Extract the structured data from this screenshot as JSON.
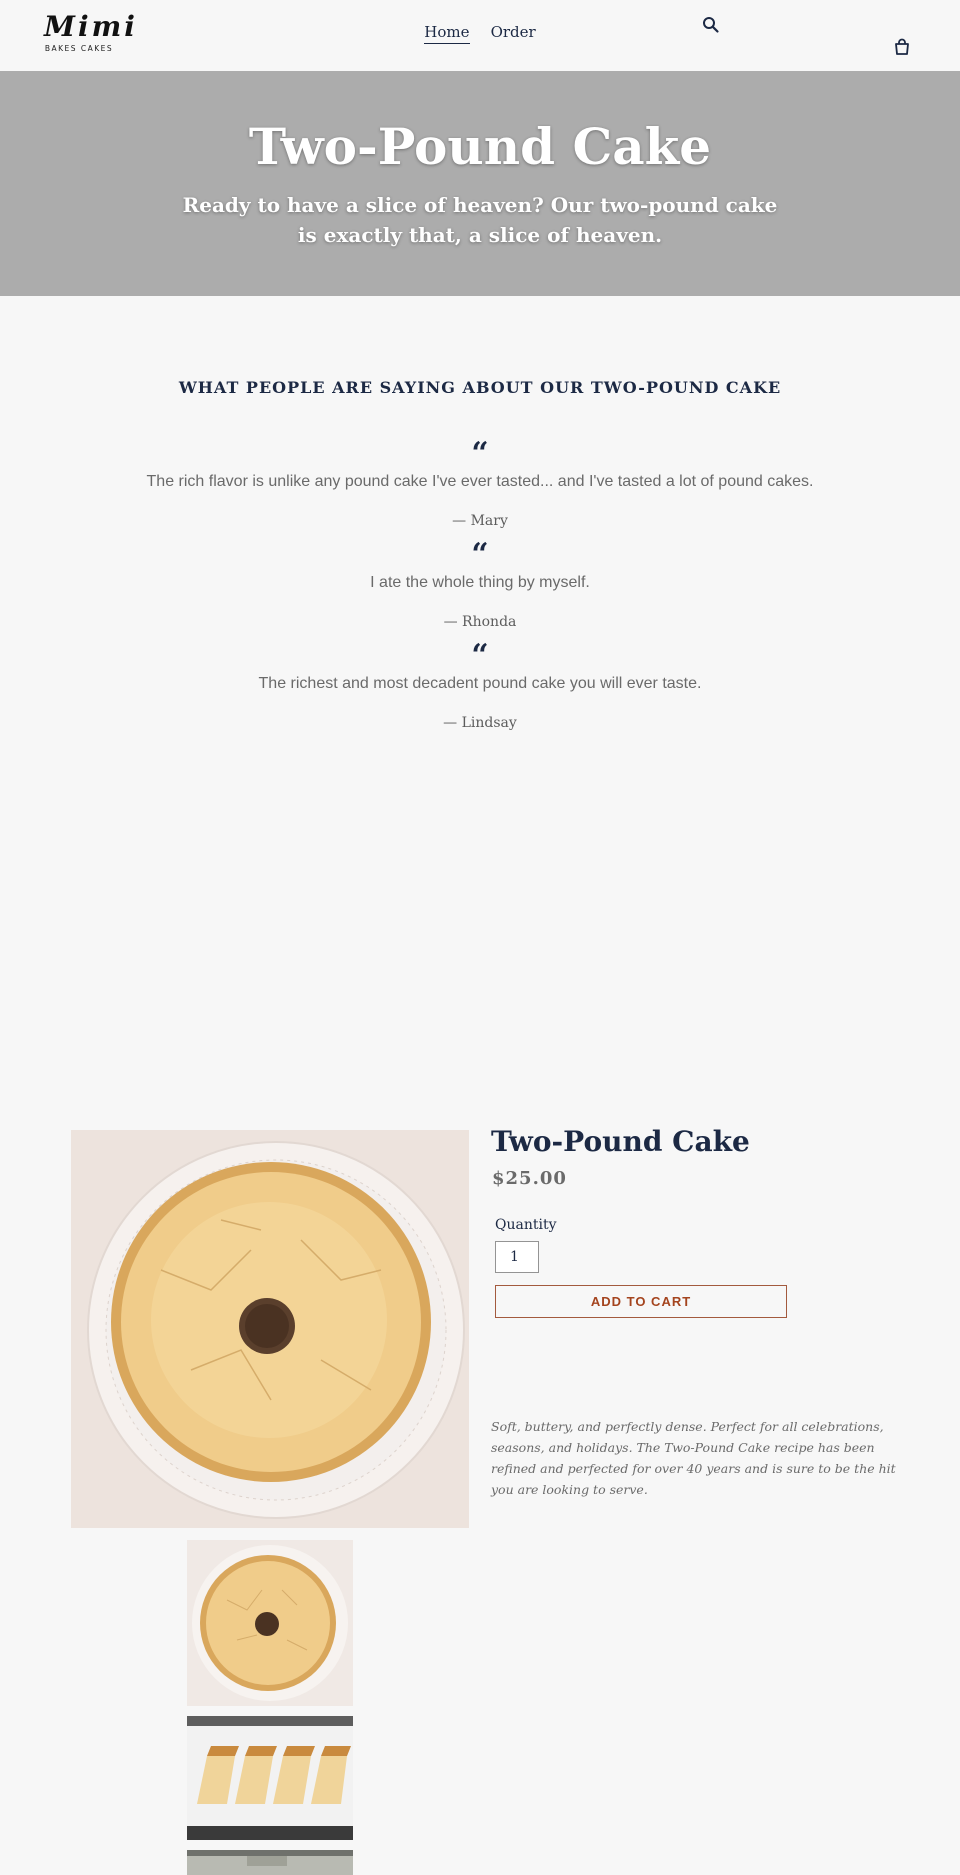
{
  "header": {
    "logo_mark": "Mimi",
    "logo_sub": "BAKES CAKES",
    "nav": [
      {
        "label": "Home",
        "active": true
      },
      {
        "label": "Order",
        "active": false
      }
    ],
    "search_icon": "search-icon",
    "cart_icon": "cart-icon"
  },
  "hero": {
    "title": "Two-Pound Cake",
    "subtitle": "Ready to have a slice of heaven?  Our two-pound cake is exactly that, a slice of heaven."
  },
  "testimonials": {
    "heading": "What people are saying about our Two-Pound Cake",
    "quote_mark": "“",
    "items": [
      {
        "text": "The rich flavor is unlike any pound cake I've ever tasted... and I've tasted a lot of pound cakes.",
        "author": "— Mary"
      },
      {
        "text": "I ate the whole thing by myself.",
        "author": "— Rhonda"
      },
      {
        "text": "The richest and most decadent pound cake you will ever taste.",
        "author": "— Lindsay"
      }
    ]
  },
  "product": {
    "title": "Two-Pound Cake",
    "price": "$25.00",
    "quantity_label": "Quantity",
    "quantity_value": "1",
    "add_to_cart": "ADD TO CART",
    "description": "Soft, buttery, and perfectly dense. Perfect for all celebrations, seasons, and holidays. The Two-Pound Cake recipe has been refined and perfected for over 40 years and is sure to be the hit you are looking to serve."
  },
  "colors": {
    "navy": "#1c2944",
    "hero_bg": "#acacac",
    "page_bg": "#f7f7f7",
    "button_accent": "#a4441e"
  }
}
